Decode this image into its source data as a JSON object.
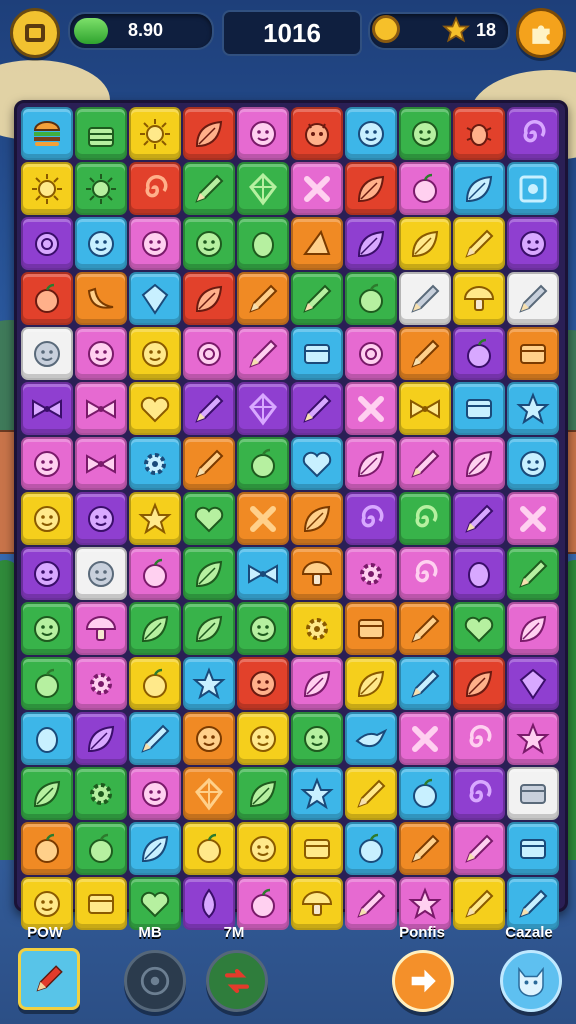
{
  "hud": {
    "menu_icon": "menu-icon",
    "energy_value": "8.90",
    "energy_fill": 0.25,
    "score": "1016",
    "coin_icon": "coin-icon",
    "star_value": "18",
    "settings_icon": "puzzle-icon"
  },
  "toolbar": {
    "pow": {
      "label": "POW",
      "icon": "pencil-icon"
    },
    "mb": {
      "label": "MB",
      "icon": "disc-icon"
    },
    "tm": {
      "label": "7M",
      "icon": "swap-icon"
    },
    "ponfis": {
      "label": "Ponfis",
      "icon": "arrow-right-icon"
    },
    "cazale": {
      "label": "Cazale",
      "icon": "cat-face-icon"
    }
  },
  "board": {
    "rows": [
      [
        "blue:burger",
        "green:cake",
        "yellow:sun",
        "red:leaf",
        "pink:face",
        "red:monster",
        "blue:face",
        "green:face",
        "red:bug",
        "purple:swirl"
      ],
      [
        "yellow:sun",
        "green:sun",
        "red:swirl",
        "green:pencil",
        "green:kite",
        "pink:cross",
        "red:leaf",
        "pink:apple",
        "blue:leaf",
        "blue:frame"
      ],
      [
        "purple:ring",
        "blue:face",
        "pink:face",
        "green:face",
        "green:egg",
        "orange:wedge",
        "purple:leaf",
        "yellow:leaf",
        "yellow:pencil",
        "purple:face"
      ],
      [
        "red:apple",
        "orange:banana",
        "blue:gem",
        "red:leaf",
        "orange:pencil",
        "green:pencil",
        "green:apple",
        "white:pencil",
        "yellow:mushroom",
        "white:pencil"
      ],
      [
        "white:face",
        "pink:face",
        "yellow:face",
        "pink:ring",
        "pink:pencil",
        "blue:box",
        "pink:ring",
        "orange:pencil",
        "purple:apple",
        "orange:box"
      ],
      [
        "purple:bow",
        "pink:bow",
        "yellow:heart",
        "purple:pencil",
        "purple:kite",
        "purple:pencil",
        "pink:cross",
        "yellow:bow",
        "blue:box",
        "blue:star"
      ],
      [
        "pink:face",
        "pink:bow",
        "blue:gear",
        "orange:pencil",
        "green:apple",
        "blue:heart",
        "pink:leaf",
        "pink:pencil",
        "pink:leaf",
        "blue:face"
      ],
      [
        "yellow:face",
        "purple:face",
        "yellow:star",
        "green:heart",
        "orange:cross",
        "orange:leaf",
        "purple:swirl",
        "green:swirl",
        "purple:pencil",
        "pink:cross"
      ],
      [
        "purple:face",
        "white:face",
        "pink:apple",
        "green:leaf",
        "blue:bow",
        "orange:mushroom",
        "pink:gear",
        "pink:swirl",
        "purple:egg",
        "green:pencil"
      ],
      [
        "green:face",
        "pink:mushroom",
        "green:leaf",
        "green:leaf",
        "green:face",
        "yellow:gear",
        "orange:box",
        "orange:pencil",
        "green:heart",
        "pink:leaf"
      ],
      [
        "green:apple",
        "pink:gear",
        "yellow:apple",
        "blue:star",
        "red:face",
        "pink:leaf",
        "yellow:leaf",
        "blue:pencil",
        "red:leaf",
        "purple:gem"
      ],
      [
        "blue:egg",
        "purple:leaf",
        "blue:pencil",
        "orange:face",
        "yellow:face",
        "green:face",
        "blue:bird",
        "pink:cross",
        "pink:swirl",
        "pink:star"
      ],
      [
        "green:leaf",
        "green:gear",
        "pink:face",
        "orange:kite",
        "green:leaf",
        "blue:star",
        "yellow:pencil",
        "blue:apple",
        "purple:swirl",
        "white:box"
      ],
      [
        "orange:apple",
        "green:apple",
        "blue:leaf",
        "yellow:apple",
        "yellow:face",
        "yellow:box",
        "blue:apple",
        "orange:pencil",
        "pink:pencil",
        "blue:box"
      ],
      [
        "yellow:face",
        "yellow:box",
        "green:heart",
        "purple:drop",
        "pink:apple",
        "yellow:mushroom",
        "pink:pencil",
        "pink:star",
        "yellow:pencil",
        "blue:pencil"
      ]
    ]
  },
  "colors": {
    "yellow": "#f5cf1c",
    "green": "#38b34a",
    "red": "#e2412b",
    "pink": "#e66ad1",
    "blue": "#3db6e8",
    "purple": "#8f3fd0",
    "orange": "#f08a24",
    "white": "#f2f2f2"
  }
}
